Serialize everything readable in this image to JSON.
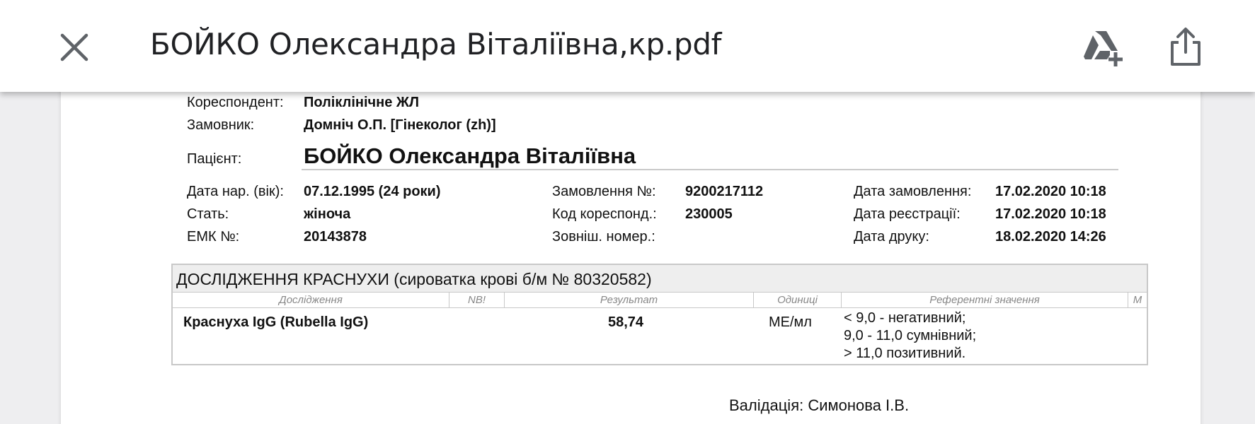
{
  "viewer": {
    "file_name": "БОЙКО Олександра Віталіївна,кр.pdf"
  },
  "header": {
    "correspondent_label": "Кореспондент:",
    "correspondent_value": "Поліклінічне ЖЛ",
    "customer_label": "Замовник:",
    "customer_value": "Домніч О.П. [Гінеколог (zh)]",
    "patient_label": "Пацієнт:",
    "patient_value": "БОЙКО Олександра Віталіївна"
  },
  "info": {
    "birth_label": "Дата нар. (вік):",
    "birth_value": "07.12.1995 (24 роки)",
    "sex_label": "Стать:",
    "sex_value": "жіноча",
    "emk_label": "ЕМК №:",
    "emk_value": "20143878",
    "order_label": "Замовлення №:",
    "order_value": "9200217112",
    "corr_code_label": "Код кореспонд.:",
    "corr_code_value": "230005",
    "ext_number_label": "Зовніш. номер.:",
    "order_date_label": "Дата замовлення:",
    "order_date_value": "17.02.2020 10:18",
    "reg_date_label": "Дата реєстрації:",
    "reg_date_value": "17.02.2020 10:18",
    "print_date_label": "Дата друку:",
    "print_date_value": "18.02.2020 14:26"
  },
  "study": {
    "title": "ДОСЛІДЖЕННЯ КРАСНУХИ  (сироватка крові б/м № 80320582)",
    "columns": [
      "Дослідження",
      "NB!",
      "Результат",
      "Одиниці",
      "Референтні значення",
      "M"
    ],
    "rows": [
      {
        "test": "Краснуха IgG  (Rubella IgG)",
        "result": "58,74",
        "units": "МЕ/мл",
        "reference": [
          "< 9,0 - негативний;",
          "9,0 - 11,0 сумнівний;",
          "> 11,0 позитивний."
        ]
      }
    ]
  },
  "validation": "Валідація: Симонова І.В."
}
